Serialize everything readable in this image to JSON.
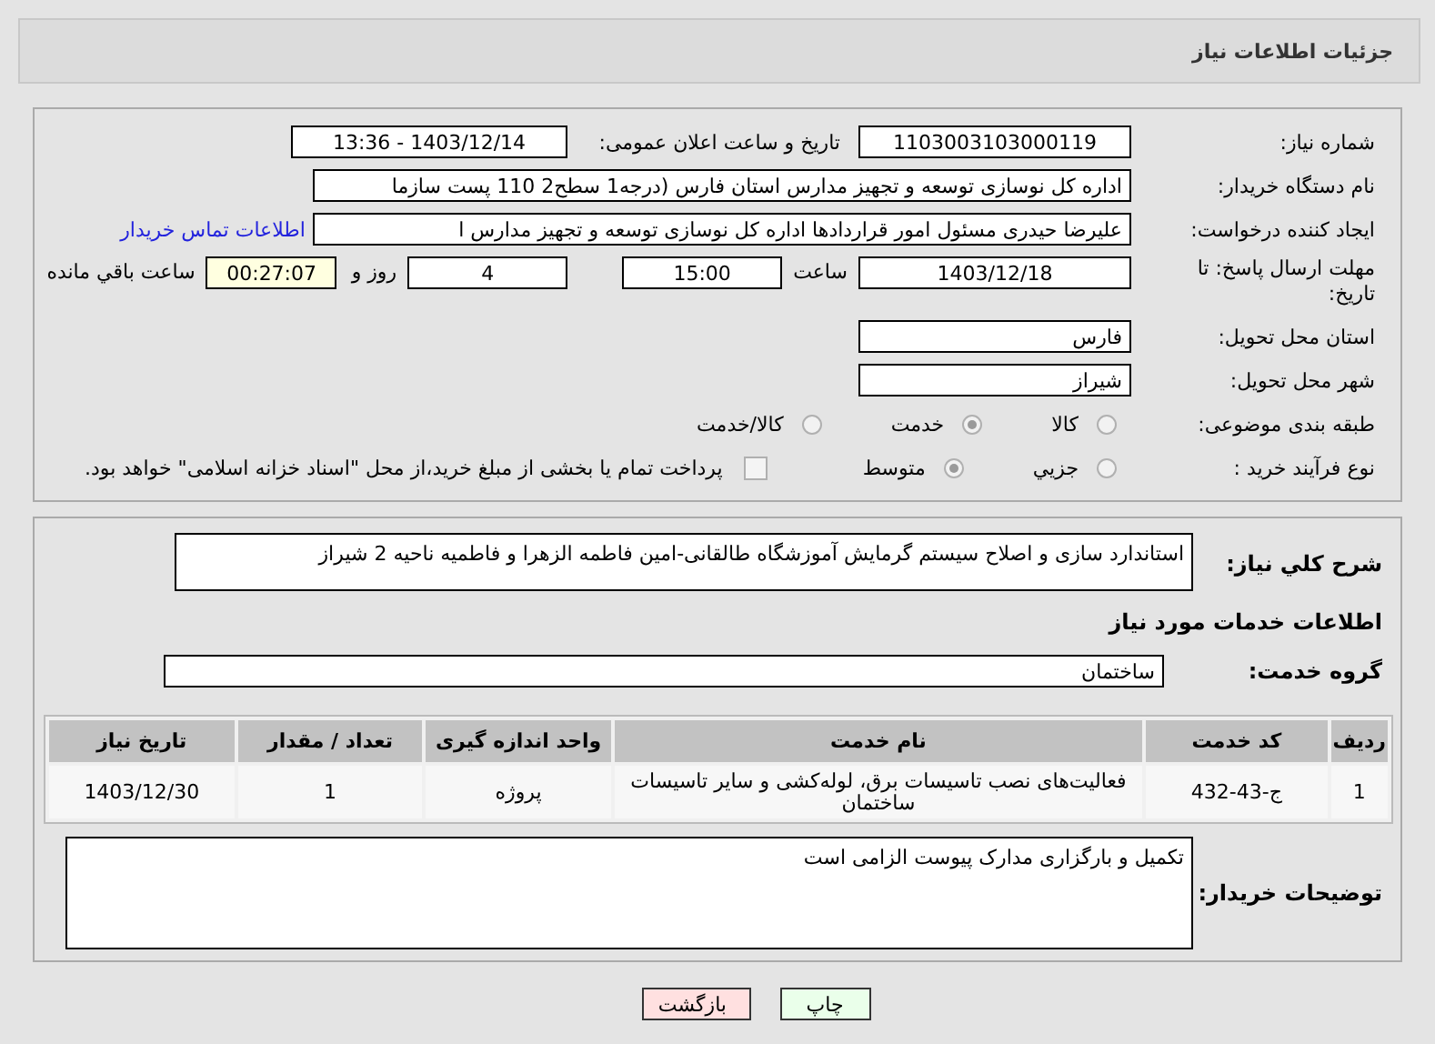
{
  "page_title": "جزئیات اطلاعات نیاز",
  "need_number": {
    "label": "شماره نیاز:",
    "value": "1103003103000119"
  },
  "announce_datetime": {
    "label": "تاریخ و ساعت اعلان عمومی:",
    "value": "1403/12/14 - 13:36"
  },
  "buyer_org": {
    "label": "نام دستگاه خریدار:",
    "value": "اداره کل نوسازی   توسعه و تجهیز مدارس استان فارس (درجه1  سطح2  110 پست سازما"
  },
  "requester": {
    "label": "ایجاد کننده درخواست:",
    "value": "علیرضا حیدری مسئول امور قراردادها اداره کل نوسازی   توسعه و تجهیز مدارس ا",
    "link": "اطلاعات تماس خریدار"
  },
  "deadline": {
    "label": "مهلت ارسال پاسخ: تا تاریخ:",
    "date": "1403/12/18",
    "time_label": "ساعت",
    "time": "15:00",
    "days": "4",
    "days_label": "روز و",
    "remaining": "00:27:07",
    "remaining_label": "ساعت باقي مانده"
  },
  "province": {
    "label": "استان محل تحویل:",
    "value": "فارس"
  },
  "city": {
    "label": "شهر محل تحویل:",
    "value": "شیراز"
  },
  "category": {
    "label": "طبقه بندی موضوعی:",
    "options": [
      {
        "label": "کالا",
        "selected": false
      },
      {
        "label": "خدمت",
        "selected": true
      },
      {
        "label": "کالا/خدمت",
        "selected": false
      }
    ]
  },
  "purchase_type": {
    "label": "نوع فرآیند خرید :",
    "options": [
      {
        "label": "جزيي",
        "selected": false
      },
      {
        "label": "متوسط",
        "selected": true
      }
    ],
    "payment_note": {
      "label": "پرداخت تمام یا بخشی از مبلغ خرید،از محل \"اسناد خزانه اسلامی\" خواهد بود.",
      "checked": false
    }
  },
  "description": {
    "label": "شرح کلي نياز:",
    "value": "استاندارد سازی و اصلاح سیستم گرمایش آموزشگاه طالقانی-امین فاطمه الزهرا و فاطمیه ناحیه 2 شیراز"
  },
  "services_heading": "اطلاعات خدمات مورد نیاز",
  "service_group": {
    "label": "گروه خدمت:",
    "value": "ساختمان"
  },
  "table": {
    "columns": [
      "ردیف",
      "کد خدمت",
      "نام خدمت",
      "واحد اندازه گیری",
      "تعداد / مقدار",
      "تاریخ نیاز"
    ],
    "rows": [
      [
        "1",
        "ج-43-432",
        "فعالیت‌های نصب تاسیسات برق، لوله‌کشی و سایر تاسیسات ساختمان",
        "پروژه",
        "1",
        "1403/12/30"
      ]
    ]
  },
  "buyer_notes": {
    "label": "توضیحات خریدار:",
    "value": "تکمیل و بارگزاری مدارک پیوست الزامی است"
  },
  "buttons": [
    {
      "label": "چاپ",
      "kind": "print"
    },
    {
      "label": "بازگشت",
      "kind": "back"
    }
  ]
}
